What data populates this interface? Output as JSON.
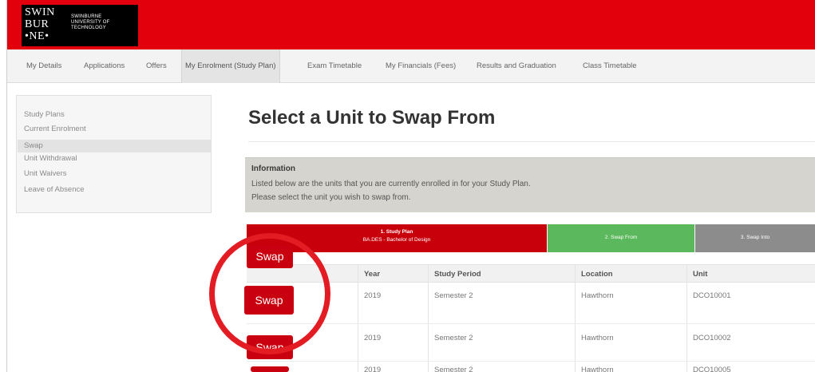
{
  "logo": {
    "mark_lines": [
      "SWIN",
      "BUR",
      "•NE•"
    ],
    "text_lines": [
      "SWINBURNE",
      "UNIVERSITY OF",
      "TECHNOLOGY"
    ]
  },
  "nav": {
    "items": [
      {
        "label": "My Details"
      },
      {
        "label": "Applications"
      },
      {
        "label": "Offers"
      },
      {
        "label": "My Enrolment (Study Plan)"
      },
      {
        "label": "Exam Timetable"
      },
      {
        "label": "My Financials (Fees)"
      },
      {
        "label": "Results and Graduation"
      },
      {
        "label": "Class Timetable"
      }
    ],
    "active_index": 3
  },
  "sidebar": {
    "items": [
      {
        "label": "Study Plans"
      },
      {
        "label": "Current Enrolment"
      },
      {
        "label": "Swap"
      },
      {
        "label": "Unit Withdrawal"
      },
      {
        "label": "Unit Waivers"
      },
      {
        "label": "Leave of Absence"
      }
    ],
    "active_index": 2
  },
  "page": {
    "title": "Select a Unit to Swap From"
  },
  "info": {
    "title": "Information",
    "line1": "Listed below are the units that you are currently enrolled in for your Study Plan.",
    "line2": "Please select the unit you wish to swap from."
  },
  "steps": [
    {
      "label": "1. Study Plan",
      "sub": "BA.DES - Bachelor of Design"
    },
    {
      "label": "2. Swap From"
    },
    {
      "label": "3. Swap Into"
    }
  ],
  "table": {
    "headers": [
      "Year",
      "Study Period",
      "Location",
      "Unit"
    ],
    "rows": [
      {
        "year": "2019",
        "period": "Semester 2",
        "location": "Hawthorn",
        "unit": "DCO10001"
      },
      {
        "year": "2019",
        "period": "Semester 2",
        "location": "Hawthorn",
        "unit": "DCO10002"
      },
      {
        "year": "2019",
        "period": "Semester 2",
        "location": "Hawthorn",
        "unit": "DCO10005"
      }
    ]
  },
  "swap_label": "Swap",
  "colors": {
    "brand_red": "#e2000d",
    "step_active": "#c7000c",
    "step_current": "#5cb85c",
    "step_pending": "#8c8c8c",
    "highlight_circle": "#e31b23"
  }
}
